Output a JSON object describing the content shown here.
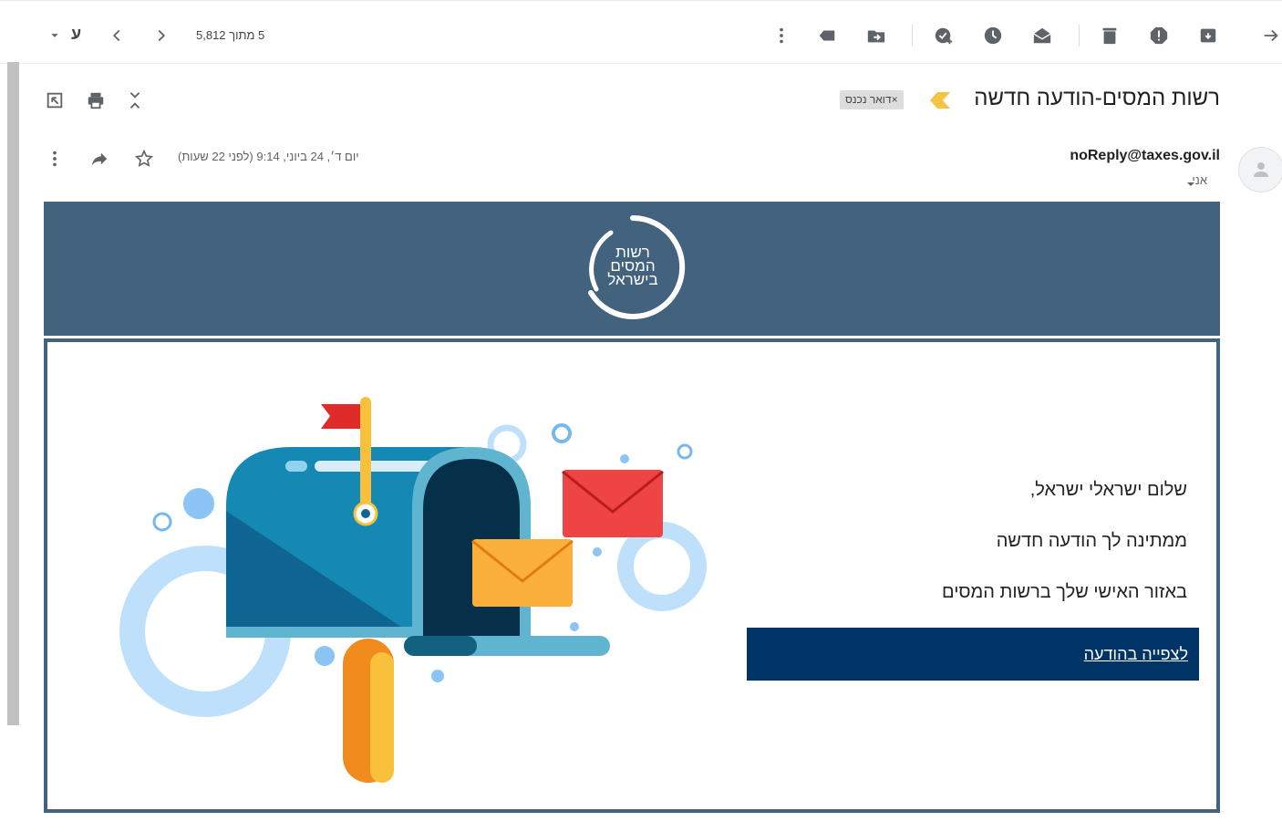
{
  "toolbar": {
    "pager_text": "5 מתוך 5,812",
    "lang_indicator": "ע",
    "icons": [
      "back-icon",
      "archive-icon",
      "report-spam-icon",
      "delete-icon",
      "mark-unread-icon",
      "snooze-icon",
      "add-to-tasks-icon",
      "move-to-icon",
      "labels-icon",
      "more-icon",
      "newer-icon",
      "older-icon",
      "input-tools-dropdown-icon"
    ]
  },
  "message": {
    "subject": "רשות המסים-הודעה חדשה",
    "label": "דואר נכנס",
    "label_close": "×",
    "sender_email": "noReply@taxes.gov.il",
    "recipient": "אני",
    "date": "יום ד׳, 24 ביוני, 9:14 (לפני 22 שעות)"
  },
  "email_body": {
    "logo_lines": [
      "רשות",
      "המסים",
      "בישראל"
    ],
    "greeting": "שלום ישראלי ישראל,",
    "line2": "ממתינה לך הודעה חדשה",
    "line3": "באזור האישי שלך ברשות המסים",
    "cta_label": "לצפייה בהודעה"
  },
  "colors": {
    "banner": "#42627e",
    "cta": "#003366",
    "importance": "#f4c542"
  }
}
